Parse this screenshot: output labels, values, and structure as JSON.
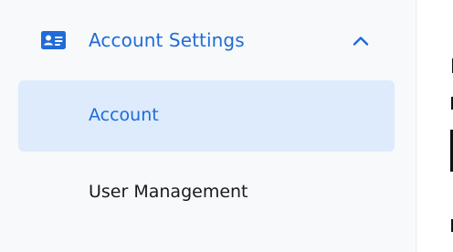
{
  "sidebar": {
    "section": {
      "label": "Account Settings",
      "icon": "id-card-icon",
      "toggle_icon": "chevron-up-icon",
      "expanded": true
    },
    "items": [
      {
        "label": "Account",
        "active": true
      },
      {
        "label": "User Management",
        "active": false
      }
    ]
  },
  "colors": {
    "accent": "#1f6bd9",
    "active_background": "#ddebfc",
    "sidebar_background": "#f8f9fb",
    "text": "#1a1a1a"
  }
}
